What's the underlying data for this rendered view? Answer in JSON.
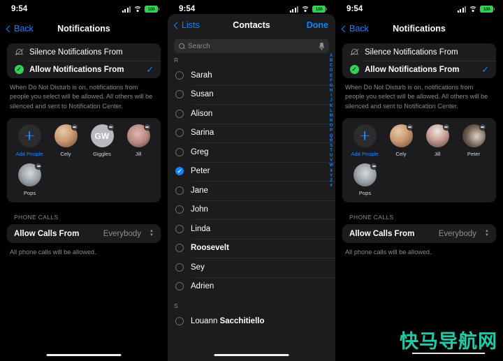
{
  "status_bar": {
    "time": "9:54",
    "battery_pct": "100",
    "signal_icon": "cellular-signal-icon",
    "wifi_icon": "wifi-icon",
    "battery_icon": "battery-icon"
  },
  "panel_left": {
    "nav": {
      "back_label": "Back",
      "title": "Notifications"
    },
    "options": [
      {
        "label": "Silence Notifications From",
        "icon": "bell-slash-icon",
        "selected": false
      },
      {
        "label": "Allow Notifications From",
        "icon": "green-check-badge-icon",
        "selected": true
      }
    ],
    "footnote": "When Do Not Disturb is on, notifications from people you select will be allowed. All others will be silenced and sent to Notification Center.",
    "people": [
      {
        "name": "Add People",
        "type": "add"
      },
      {
        "name": "Cely",
        "type": "photo",
        "tint": "#c89a74"
      },
      {
        "name": "Giggles",
        "type": "initials",
        "initials": "GW"
      },
      {
        "name": "Jill",
        "type": "photo",
        "tint": "#b98a84"
      },
      {
        "name": "Pops",
        "type": "photo",
        "tint": "#9aa0a6"
      }
    ],
    "phone_section_header": "PHONE CALLS",
    "calls_row": {
      "label": "Allow Calls From",
      "value": "Everybody"
    },
    "calls_footnote": "All phone calls will be allowed."
  },
  "panel_middle": {
    "nav": {
      "back_label": "Lists",
      "title": "Contacts",
      "done_label": "Done"
    },
    "search": {
      "placeholder": "Search",
      "value": "",
      "search_icon": "search-icon",
      "mic_icon": "microphone-icon"
    },
    "sections": [
      {
        "letter": "R",
        "contacts": [
          {
            "first": "Sarah",
            "last": "",
            "selected": false
          },
          {
            "first": "Susan",
            "last": "",
            "selected": false
          },
          {
            "first": "Alison",
            "last": "",
            "selected": false
          },
          {
            "first": "Sarina",
            "last": "",
            "selected": false
          },
          {
            "first": "Greg",
            "last": "",
            "selected": false
          },
          {
            "first": "Peter",
            "last": "",
            "selected": true
          },
          {
            "first": "Jane",
            "last": "",
            "selected": false
          },
          {
            "first": "John",
            "last": "",
            "selected": false
          },
          {
            "first": "Linda",
            "last": "",
            "selected": false
          },
          {
            "first": "",
            "last": "Roosevelt",
            "selected": false
          },
          {
            "first": "Sey",
            "last": "",
            "selected": false
          },
          {
            "first": "Adrien",
            "last": "",
            "selected": false
          }
        ]
      },
      {
        "letter": "S",
        "contacts": [
          {
            "first": "Louann ",
            "last": "Sacchitiello",
            "selected": false
          }
        ]
      }
    ],
    "alpha_index": [
      "A",
      "B",
      "C",
      "D",
      "E",
      "F",
      "G",
      "H",
      "I",
      "J",
      "K",
      "L",
      "M",
      "N",
      "O",
      "P",
      "Q",
      "R",
      "S",
      "T",
      "U",
      "V",
      "W",
      "X",
      "Y",
      "Z",
      "#"
    ]
  },
  "panel_right": {
    "nav": {
      "back_label": "Back",
      "title": "Notifications"
    },
    "options": [
      {
        "label": "Silence Notifications From",
        "icon": "bell-slash-icon",
        "selected": false
      },
      {
        "label": "Allow Notifications From",
        "icon": "green-check-badge-icon",
        "selected": true
      }
    ],
    "footnote": "When Do Not Disturb is on, notifications from people you select will be allowed. All others will be silenced and sent to Notification Center.",
    "people": [
      {
        "name": "Add People",
        "type": "add"
      },
      {
        "name": "Cely",
        "type": "photo",
        "tint": "#c89a74"
      },
      {
        "name": "Jill",
        "type": "photo",
        "tint": "#c49b93"
      },
      {
        "name": "Peter",
        "type": "photo",
        "tint": "#6e5d50"
      },
      {
        "name": "Pops",
        "type": "photo",
        "tint": "#9aa0a6"
      }
    ],
    "phone_section_header": "PHONE CALLS",
    "calls_row": {
      "label": "Allow Calls From",
      "value": "Everybody"
    },
    "calls_footnote": "All phone calls will be allowed."
  },
  "watermark": {
    "text": "快马导航网",
    "color": "#22c8a8"
  },
  "colors": {
    "accent_blue": "#0a84ff",
    "green": "#30d158",
    "card": "#1c1c1e",
    "bg": "#000000",
    "secondary_text": "#8e8e93"
  }
}
